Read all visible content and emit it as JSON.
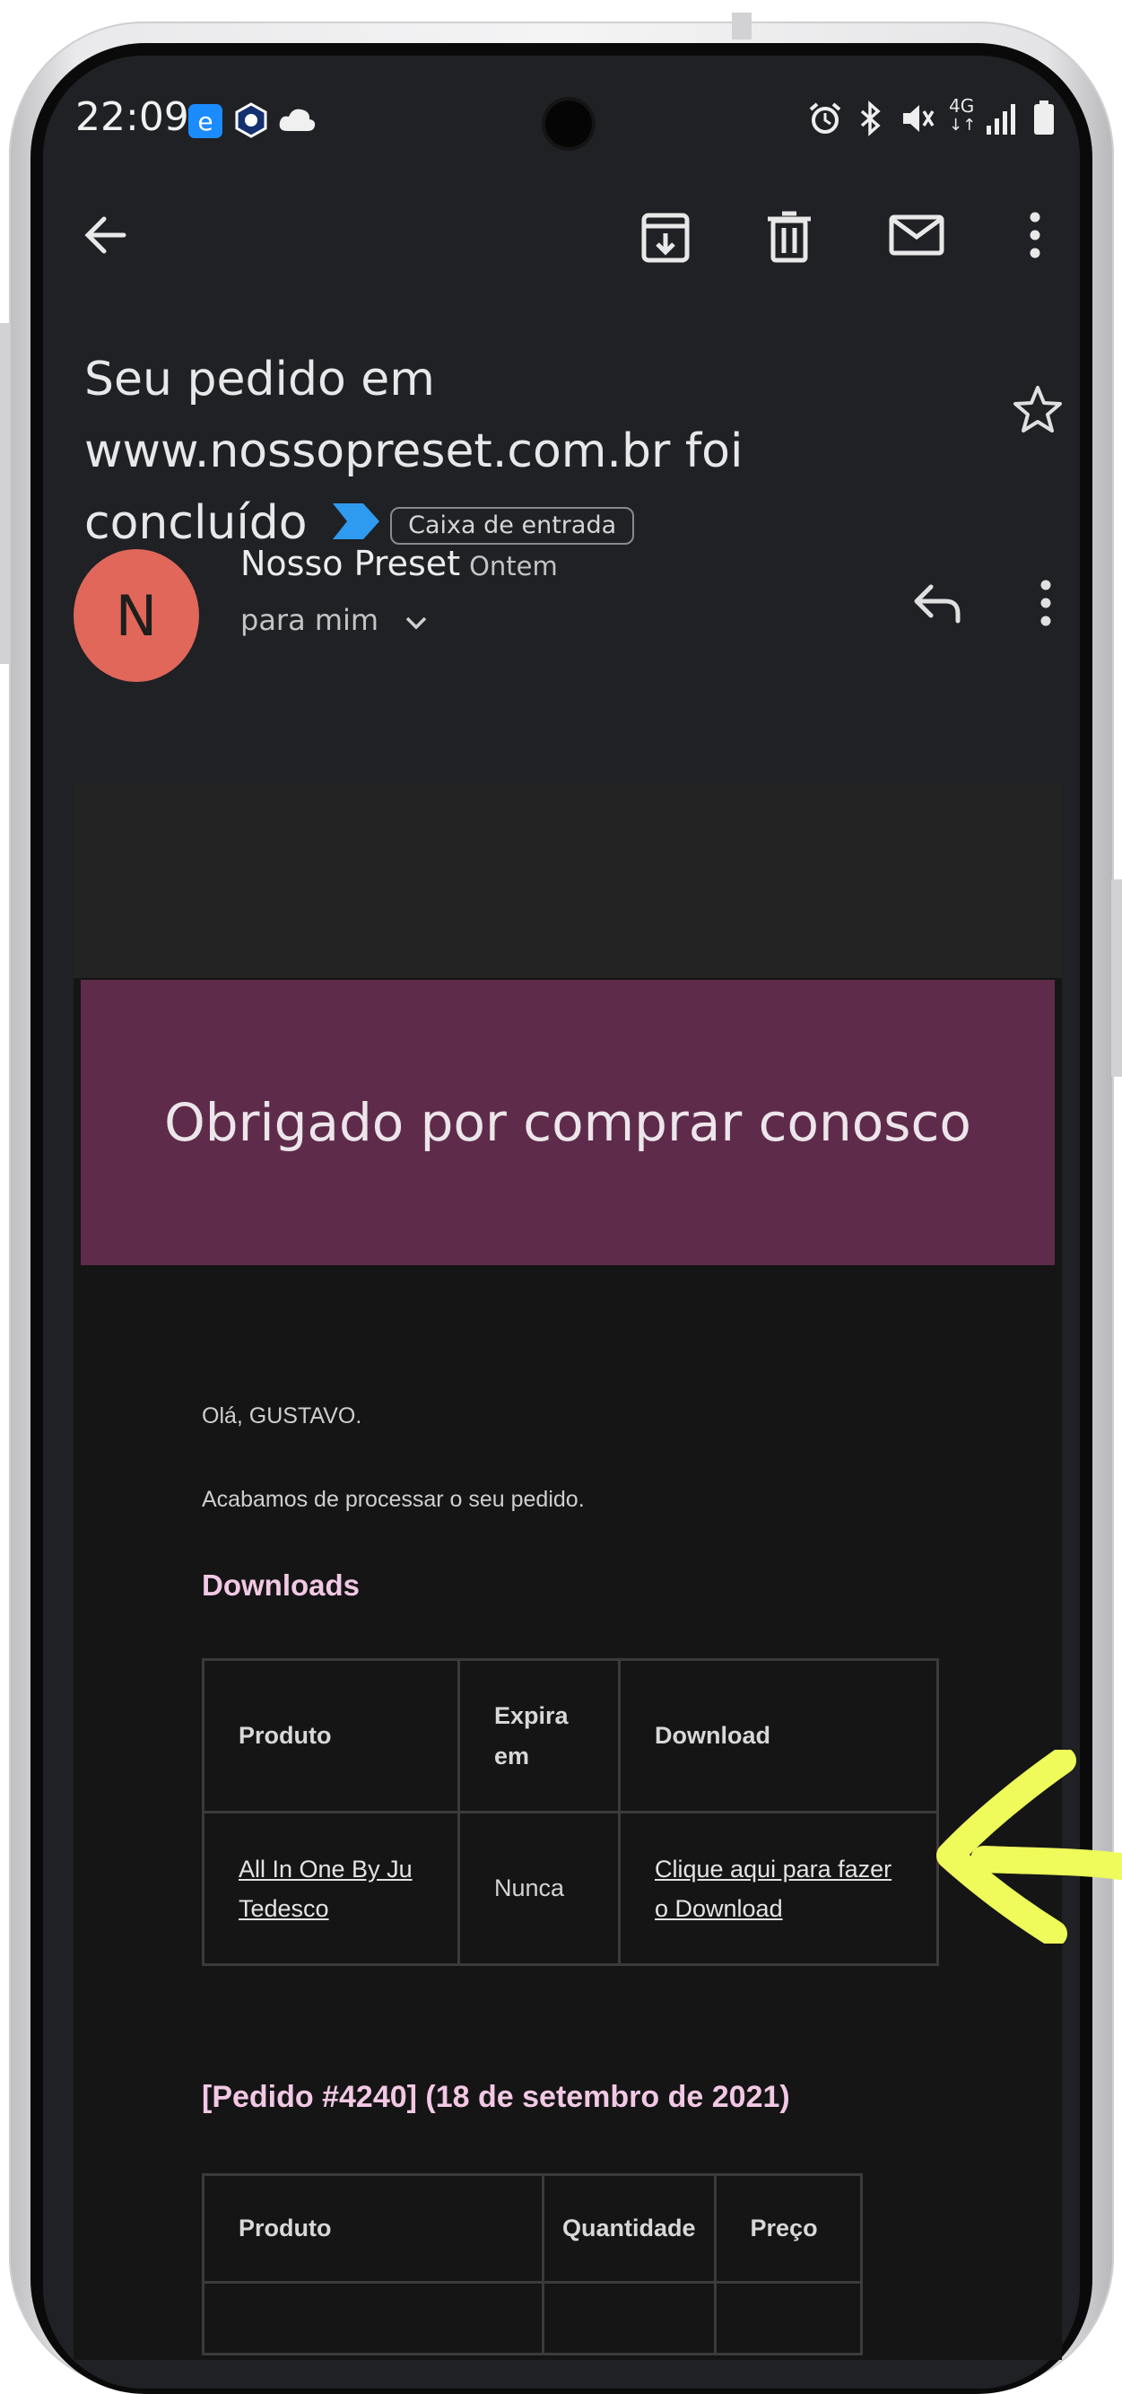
{
  "status_bar": {
    "time": "22:09",
    "left_icons": [
      "edge-icon",
      "crypto-icon",
      "cloud-icon"
    ],
    "right_icons": [
      "alarm-icon",
      "bluetooth-icon",
      "mute-icon",
      "4g-icon",
      "signal-icon",
      "battery-icon"
    ],
    "network": "4G"
  },
  "toolbar": {
    "icons": [
      "back-arrow-icon",
      "archive-icon",
      "delete-icon",
      "mark-unread-icon",
      "more-vert-icon"
    ]
  },
  "email": {
    "subject": "Seu pedido em www.nossopreset.com.br foi concluído",
    "label": "Caixa de entrada",
    "sender": {
      "initial": "N",
      "name": "Nosso Preset",
      "date": "Ontem",
      "to": "para mim"
    }
  },
  "message": {
    "banner": "Obrigado por comprar conosco",
    "greeting": "Olá, GUSTAVO.",
    "intro": "Acabamos de processar o seu pedido.",
    "downloads_heading": "Downloads",
    "downloads_table": {
      "headers": [
        "Produto",
        "Expira em",
        "Download"
      ],
      "rows": [
        [
          "All In One By Ju Tedesco",
          "Nunca",
          "Clique aqui para fazer o Download"
        ]
      ]
    },
    "order_heading": "[Pedido #4240] (18 de setembro de 2021)",
    "order_table": {
      "headers": [
        "Produto",
        "Quantidade",
        "Preço"
      ]
    }
  },
  "colors": {
    "screen_bg": "#1f2125",
    "avatar": "#e0675a",
    "banner": "#5f2b4b",
    "heading": "#f2c8e4",
    "annotation_arrow": "#eefb5a"
  }
}
